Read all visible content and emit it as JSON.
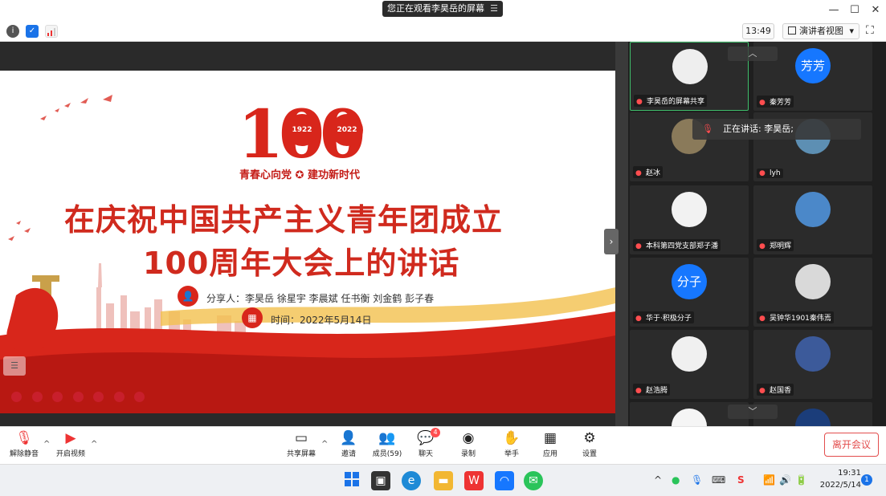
{
  "window": {
    "share_banner": "您正在观看李昊岳的屏幕",
    "menu_glyph": "☰",
    "controls": {
      "minimize": "—",
      "maximize": "☐",
      "close": "✕"
    }
  },
  "toolbar": {
    "clock": "13:49",
    "view_mode": "演讲者视图",
    "view_caret": "▾"
  },
  "slide": {
    "logo_digits": "100",
    "year_start": "1922",
    "year_end": "2022",
    "slogan": "青春心向党 ✪ 建功新时代",
    "title_line1": "在庆祝中国共产主义青年团成立",
    "title_line2": "100周年大会上的讲话",
    "presenters": "分享人：李昊岳  徐星宇  李晨斌  任书衡  刘金鹤  彭子春",
    "date": "时间：2022年5月14日",
    "menu_glyph": "☰"
  },
  "participants": {
    "speaking": "正在讲话: 李昊岳;",
    "tiles": [
      {
        "name": "李昊岳的屏幕共享",
        "avatar_text": "",
        "avatar_color": "#eeeeee",
        "active": true
      },
      {
        "name": "秦芳芳",
        "avatar_text": "芳芳",
        "avatar_color": "#1677ff",
        "active": false
      },
      {
        "name": "赵冰",
        "avatar_text": "",
        "avatar_color": "#8a7a5a",
        "active": false
      },
      {
        "name": "lyh",
        "avatar_text": "",
        "avatar_color": "#5d8fb3",
        "active": false
      },
      {
        "name": "本科第四党支部郑子潘",
        "avatar_text": "",
        "avatar_color": "#f2f2f2",
        "active": false
      },
      {
        "name": "郑明辉",
        "avatar_text": "",
        "avatar_color": "#4b88c9",
        "active": false
      },
      {
        "name": "华于·积极分子",
        "avatar_text": "分子",
        "avatar_color": "#1677ff",
        "active": false
      },
      {
        "name": "吴钟华1901秦伟焉",
        "avatar_text": "",
        "avatar_color": "#d9d9d9",
        "active": false
      },
      {
        "name": "赵浩腾",
        "avatar_text": "",
        "avatar_color": "#f0f0f0",
        "active": false
      },
      {
        "name": "赵国香",
        "avatar_text": "",
        "avatar_color": "#3c5a9a",
        "active": false
      },
      {
        "name": "",
        "avatar_text": "",
        "avatar_color": "#f5f5f5",
        "active": false
      },
      {
        "name": "",
        "avatar_text": "",
        "avatar_color": "#1b3d7a",
        "active": false
      }
    ],
    "scroll_up": "︿",
    "scroll_down": "﹀"
  },
  "meeting_bar": {
    "unmute": "解除静音",
    "start_video": "开启视频",
    "share_screen": "共享屏幕",
    "invite": "邀请",
    "members": "成员(59)",
    "chat": "聊天",
    "chat_badge": "4",
    "record": "录制",
    "raise_hand": "举手",
    "apps": "应用",
    "settings": "设置",
    "leave": "离开会议",
    "caret": "^"
  },
  "taskbar": {
    "time": "19:31",
    "date": "2022/5/14",
    "notifications": "1",
    "tray_caret": "^"
  },
  "colors": {
    "party_red": "#d8261b",
    "leave_red": "#e34d4d",
    "active_green": "#3fbf6b",
    "avatar_blue": "#1677ff"
  }
}
